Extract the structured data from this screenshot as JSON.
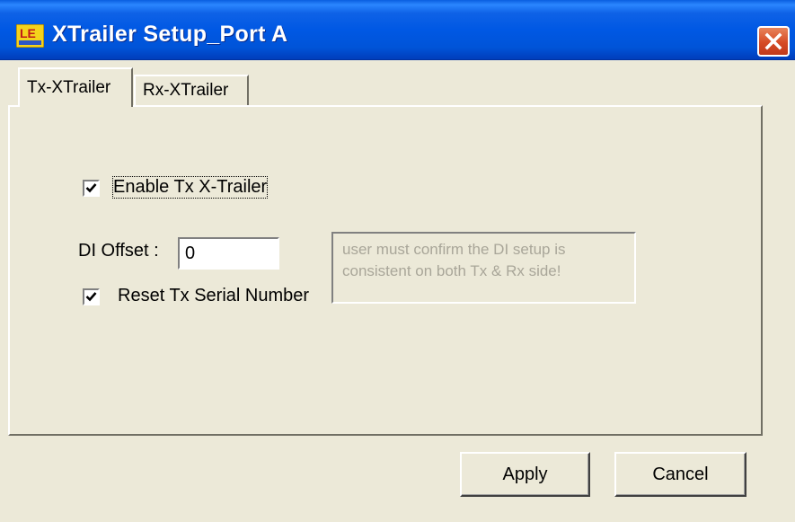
{
  "window": {
    "title": "XTrailer Setup_Port A",
    "icon": "le-app-icon",
    "close_icon": "close-icon"
  },
  "tabs": [
    {
      "label": "Tx-XTrailer",
      "selected": true
    },
    {
      "label": "Rx-XTrailer",
      "selected": false
    }
  ],
  "tx_xtrailer": {
    "enable_checkbox": {
      "label": "Enable Tx X-Trailer",
      "checked": true
    },
    "di_offset": {
      "label": "DI Offset :",
      "value": "0"
    },
    "reset_checkbox": {
      "label": "Reset Tx Serial Number",
      "checked": true
    },
    "note": "user must confirm the DI setup is consistent on both Tx & Rx side!"
  },
  "buttons": {
    "apply": "Apply",
    "cancel": "Cancel"
  },
  "colors": {
    "titlebar": "#0054e3",
    "dialog_background": "#ece9d8",
    "close_button": "#d64b25",
    "disabled_text": "#a9a699"
  }
}
